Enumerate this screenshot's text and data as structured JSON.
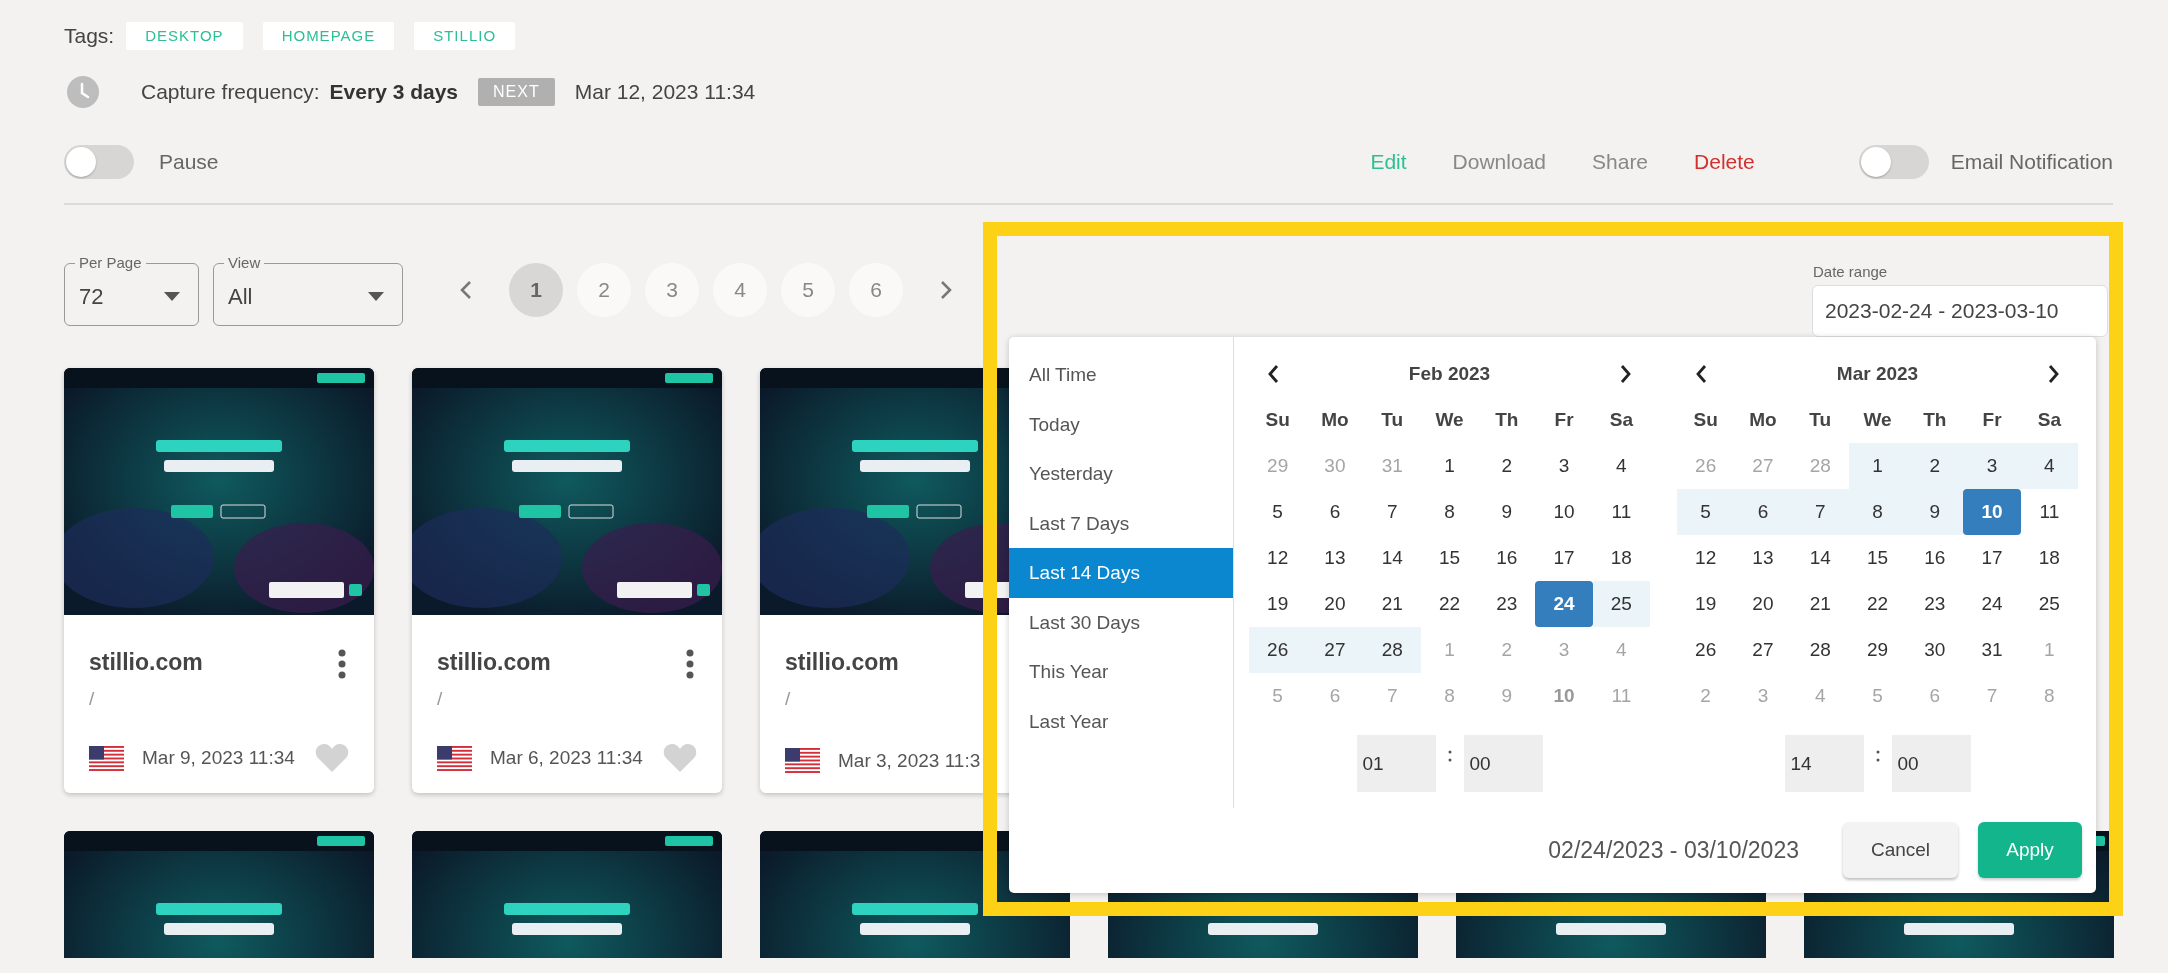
{
  "tags": {
    "label": "Tags:",
    "items": [
      "DESKTOP",
      "HOMEPAGE",
      "STILLIO"
    ]
  },
  "capture": {
    "label": "Capture frequency:",
    "value": "Every 3 days",
    "badge": "NEXT",
    "next": "Mar 12, 2023 11:34"
  },
  "pause": {
    "label": "Pause",
    "on": false
  },
  "actions": [
    {
      "label": "Edit",
      "kind": "edit"
    },
    {
      "label": "Download",
      "kind": "plain"
    },
    {
      "label": "Share",
      "kind": "plain"
    },
    {
      "label": "Delete",
      "kind": "danger"
    }
  ],
  "email_notification": {
    "label": "Email Notification",
    "on": false
  },
  "per_page": {
    "label": "Per Page",
    "value": "72"
  },
  "view": {
    "label": "View",
    "value": "All"
  },
  "pagination": [
    {
      "label": "1",
      "selected": true
    },
    {
      "label": "2",
      "selected": false
    },
    {
      "label": "3",
      "selected": false
    },
    {
      "label": "4",
      "selected": false
    },
    {
      "label": "5",
      "selected": false
    },
    {
      "label": "6",
      "selected": false
    }
  ],
  "date_range": {
    "label": "Date range",
    "value": "2023-02-24 - 2023-03-10"
  },
  "cards": [
    {
      "site": "stillio.com",
      "path": "/",
      "date": "Mar 9, 2023 11:34",
      "menu": true,
      "favorite": false
    },
    {
      "site": "stillio.com",
      "path": "/",
      "date": "Mar 6, 2023 11:34",
      "menu": true,
      "favorite": false
    },
    {
      "site": "stillio.com",
      "path": "/",
      "date": "Mar 3, 2023 11:3",
      "menu": false
    }
  ],
  "date_picker": {
    "ranges": [
      {
        "label": "All Time",
        "selected": false
      },
      {
        "label": "Today",
        "selected": false
      },
      {
        "label": "Yesterday",
        "selected": false
      },
      {
        "label": "Last 7 Days",
        "selected": false
      },
      {
        "label": "Last 14 Days",
        "selected": true
      },
      {
        "label": "Last 30 Days",
        "selected": false
      },
      {
        "label": "This Year",
        "selected": false
      },
      {
        "label": "Last Year",
        "selected": false
      }
    ],
    "calendars": [
      {
        "title": "Feb 2023",
        "weekdays": [
          "Su",
          "Mo",
          "Tu",
          "We",
          "Th",
          "Fr",
          "Sa"
        ],
        "time": {
          "hour": "01",
          "minute": "00"
        },
        "weeks": [
          [
            {
              "day": "29",
              "kind": "off"
            },
            {
              "day": "30",
              "kind": "off"
            },
            {
              "day": "31",
              "kind": "off"
            },
            {
              "day": "1",
              "kind": "day"
            },
            {
              "day": "2",
              "kind": "day"
            },
            {
              "day": "3",
              "kind": "day"
            },
            {
              "day": "4",
              "kind": "day"
            }
          ],
          [
            {
              "day": "5",
              "kind": "day"
            },
            {
              "day": "6",
              "kind": "day"
            },
            {
              "day": "7",
              "kind": "day"
            },
            {
              "day": "8",
              "kind": "day"
            },
            {
              "day": "9",
              "kind": "day"
            },
            {
              "day": "10",
              "kind": "day"
            },
            {
              "day": "11",
              "kind": "day"
            }
          ],
          [
            {
              "day": "12",
              "kind": "day"
            },
            {
              "day": "13",
              "kind": "day"
            },
            {
              "day": "14",
              "kind": "day"
            },
            {
              "day": "15",
              "kind": "day"
            },
            {
              "day": "16",
              "kind": "day"
            },
            {
              "day": "17",
              "kind": "day"
            },
            {
              "day": "18",
              "kind": "day"
            }
          ],
          [
            {
              "day": "19",
              "kind": "day"
            },
            {
              "day": "20",
              "kind": "day"
            },
            {
              "day": "21",
              "kind": "day"
            },
            {
              "day": "22",
              "kind": "day"
            },
            {
              "day": "23",
              "kind": "day"
            },
            {
              "day": "24",
              "kind": "active"
            },
            {
              "day": "25",
              "kind": "range"
            }
          ],
          [
            {
              "day": "26",
              "kind": "range"
            },
            {
              "day": "27",
              "kind": "range"
            },
            {
              "day": "28",
              "kind": "range"
            },
            {
              "day": "1",
              "kind": "off"
            },
            {
              "day": "2",
              "kind": "off"
            },
            {
              "day": "3",
              "kind": "off"
            },
            {
              "day": "4",
              "kind": "off"
            }
          ],
          [
            {
              "day": "5",
              "kind": "off"
            },
            {
              "day": "6",
              "kind": "off"
            },
            {
              "day": "7",
              "kind": "off"
            },
            {
              "day": "8",
              "kind": "off"
            },
            {
              "day": "9",
              "kind": "off"
            },
            {
              "day": "10",
              "kind": "off-bold"
            },
            {
              "day": "11",
              "kind": "off"
            }
          ]
        ]
      },
      {
        "title": "Mar 2023",
        "weekdays": [
          "Su",
          "Mo",
          "Tu",
          "We",
          "Th",
          "Fr",
          "Sa"
        ],
        "time": {
          "hour": "14",
          "minute": "00"
        },
        "weeks": [
          [
            {
              "day": "26",
              "kind": "off"
            },
            {
              "day": "27",
              "kind": "off"
            },
            {
              "day": "28",
              "kind": "off"
            },
            {
              "day": "1",
              "kind": "range"
            },
            {
              "day": "2",
              "kind": "range"
            },
            {
              "day": "3",
              "kind": "range"
            },
            {
              "day": "4",
              "kind": "range"
            }
          ],
          [
            {
              "day": "5",
              "kind": "range"
            },
            {
              "day": "6",
              "kind": "range"
            },
            {
              "day": "7",
              "kind": "range"
            },
            {
              "day": "8",
              "kind": "range"
            },
            {
              "day": "9",
              "kind": "range"
            },
            {
              "day": "10",
              "kind": "active"
            },
            {
              "day": "11",
              "kind": "day"
            }
          ],
          [
            {
              "day": "12",
              "kind": "day"
            },
            {
              "day": "13",
              "kind": "day"
            },
            {
              "day": "14",
              "kind": "day"
            },
            {
              "day": "15",
              "kind": "day"
            },
            {
              "day": "16",
              "kind": "day"
            },
            {
              "day": "17",
              "kind": "day"
            },
            {
              "day": "18",
              "kind": "day"
            }
          ],
          [
            {
              "day": "19",
              "kind": "day"
            },
            {
              "day": "20",
              "kind": "day"
            },
            {
              "day": "21",
              "kind": "day"
            },
            {
              "day": "22",
              "kind": "day"
            },
            {
              "day": "23",
              "kind": "day"
            },
            {
              "day": "24",
              "kind": "day"
            },
            {
              "day": "25",
              "kind": "day"
            }
          ],
          [
            {
              "day": "26",
              "kind": "day"
            },
            {
              "day": "27",
              "kind": "day"
            },
            {
              "day": "28",
              "kind": "day"
            },
            {
              "day": "29",
              "kind": "day"
            },
            {
              "day": "30",
              "kind": "day"
            },
            {
              "day": "31",
              "kind": "day"
            },
            {
              "day": "1",
              "kind": "off"
            }
          ],
          [
            {
              "day": "2",
              "kind": "off"
            },
            {
              "day": "3",
              "kind": "off"
            },
            {
              "day": "4",
              "kind": "off"
            },
            {
              "day": "5",
              "kind": "off"
            },
            {
              "day": "6",
              "kind": "off"
            },
            {
              "day": "7",
              "kind": "off"
            },
            {
              "day": "8",
              "kind": "off"
            }
          ]
        ]
      }
    ],
    "selection": "02/24/2023 - 03/10/2023",
    "buttons": [
      {
        "label": "Cancel",
        "kind": "cancel"
      },
      {
        "label": "Apply",
        "kind": "apply"
      }
    ]
  }
}
